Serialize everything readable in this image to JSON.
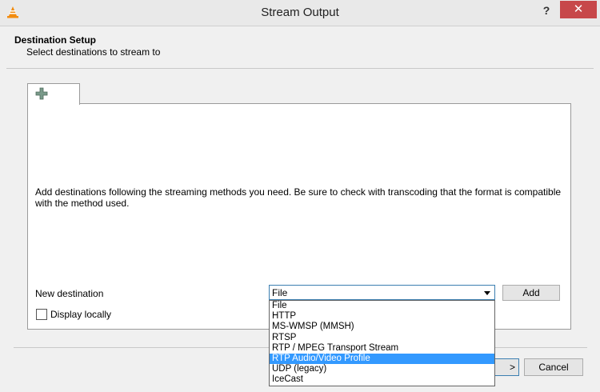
{
  "window": {
    "title": "Stream Output",
    "help_label": "?",
    "close_label": "✕"
  },
  "header": {
    "title": "Destination Setup",
    "subtitle": "Select destinations to stream to"
  },
  "tab": {
    "icon": "plus-icon"
  },
  "main": {
    "info_text": "Add destinations following the streaming methods you need. Be sure to check with transcoding that the format is compatible with the method used.",
    "new_destination_label": "New destination",
    "combo_value": "File",
    "add_button": "Add",
    "display_locally": "Display locally"
  },
  "dropdown": {
    "items": [
      "File",
      "HTTP",
      "MS-WMSP (MMSH)",
      "RTSP",
      "RTP / MPEG Transport Stream",
      "RTP Audio/Video Profile",
      "UDP (legacy)",
      "IceCast"
    ],
    "selected_index": 5
  },
  "footer": {
    "next_button": ">",
    "cancel_button": "Cancel"
  },
  "colors": {
    "accent": "#3399ff",
    "close": "#c7484a",
    "vlc_orange": "#f28c0f"
  }
}
